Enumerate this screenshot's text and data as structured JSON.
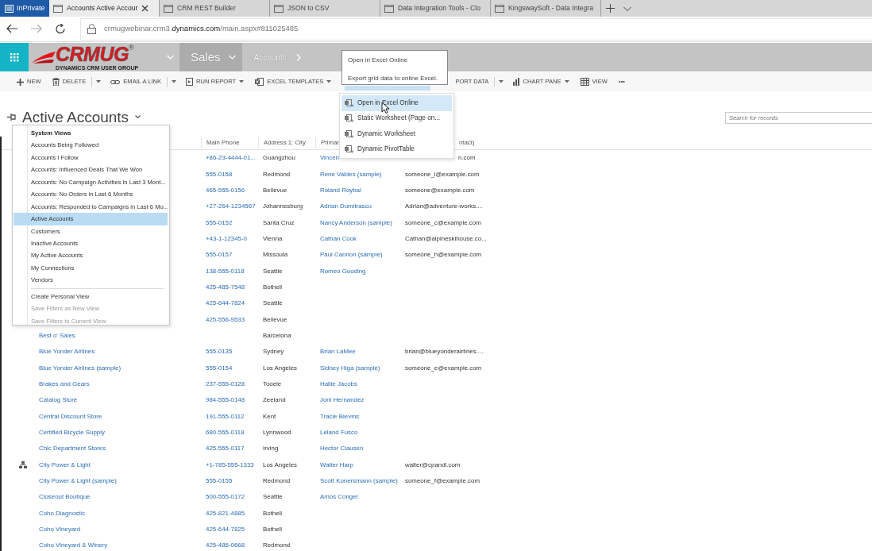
{
  "browser": {
    "private_label": "InPrivate",
    "tabs": [
      {
        "title": "Accounts Active Accour",
        "selected": true
      },
      {
        "title": "CRM REST Builder",
        "selected": false
      },
      {
        "title": "JSON to CSV",
        "selected": false
      },
      {
        "title": "Data Integration Tools - Clo",
        "selected": false
      },
      {
        "title": "KingswaySoft - Data Integra",
        "selected": false
      }
    ],
    "url": {
      "prefix": "crmugwebinar.crm3.",
      "domain": "dynamics.com",
      "path": "/main.aspx#811025485"
    }
  },
  "app_bar": {
    "logo": {
      "name": "CRMUG",
      "mark": "®",
      "tagline": "DYNAMICS CRM USER GROUP"
    },
    "area": "Sales",
    "breadcrumb": "Accounts"
  },
  "toolbar": {
    "items_before": [
      {
        "kind": "new",
        "label": "NEW",
        "dropdown": false
      },
      {
        "kind": "delete",
        "label": "DELETE",
        "dropdown": false
      },
      {
        "kind": "split",
        "dropdown": true
      },
      {
        "kind": "link",
        "label": "EMAIL A LINK",
        "dropdown": false
      },
      {
        "kind": "split",
        "dropdown": true
      },
      {
        "kind": "report",
        "label": "RUN REPORT",
        "dropdown": true
      },
      {
        "kind": "excel",
        "label": "EXCEL TEMPLATES",
        "dropdown": true
      }
    ],
    "export_button": {
      "highlighted": true
    },
    "items_after": [
      {
        "kind": "import",
        "label": "PORT DATA",
        "dropdown": false
      },
      {
        "kind": "split",
        "dropdown": true
      },
      {
        "kind": "chart",
        "label": "CHART PANE",
        "dropdown": true
      },
      {
        "kind": "view",
        "label": "VIEW",
        "dropdown": false
      },
      {
        "kind": "more",
        "label": "•••",
        "dropdown": false
      }
    ]
  },
  "tooltip": {
    "title": "Open in Excel Online",
    "description": "Export grid data to online Excel."
  },
  "export_menu": [
    {
      "label": "Open in Excel Online",
      "selected": true
    },
    {
      "label": "Static Worksheet (Page on...",
      "selected": false
    },
    {
      "label": "Dynamic Worksheet",
      "selected": false
    },
    {
      "label": "Dynamic PivotTable",
      "selected": false
    }
  ],
  "page_title": "Active Accounts",
  "search": {
    "placeholder": "Search for records"
  },
  "views_menu": {
    "heading": "System Views",
    "views": [
      {
        "label": "Accounts Being Followed",
        "selected": false
      },
      {
        "label": "Accounts I Follow",
        "selected": false
      },
      {
        "label": "Accounts: Influenced Deals That We Won",
        "selected": false
      },
      {
        "label": "Accounts: No Campaign Activities in Last 3 Mont...",
        "selected": false
      },
      {
        "label": "Accounts: No Orders in Last 6 Months",
        "selected": false
      },
      {
        "label": "Accounts: Responded to Campaigns in Last 6 Mo...",
        "selected": false
      },
      {
        "label": "Active Accounts",
        "selected": true
      },
      {
        "label": "Customers",
        "selected": false
      },
      {
        "label": "Inactive Accounts",
        "selected": false
      },
      {
        "label": "My Active Accounts",
        "selected": false
      },
      {
        "label": "My Connections",
        "selected": false
      },
      {
        "label": "Vendors",
        "selected": false
      }
    ],
    "actions": [
      {
        "label": "Create Personal View",
        "disabled": false
      },
      {
        "label": "Save Filters as New View",
        "disabled": true
      },
      {
        "label": "Save Filters to Current View",
        "disabled": true
      }
    ]
  },
  "grid": {
    "columns": [
      "Main Phone",
      "Address 1: City",
      "Primar",
      "ntact)"
    ],
    "rows": [
      {
        "phone": "+86-23-4444-01...",
        "city": "Guangzhou",
        "contact": "Vincen",
        "email": "n.com",
        "hierarchy": false
      },
      {
        "phone": "555-0158",
        "city": "Redmond",
        "contact": "Rene Valdes (sample)",
        "email": "someone_i@example.com",
        "hierarchy": false
      },
      {
        "phone": "465-555-0156",
        "city": "Bellevue",
        "contact": "Roland Roybal",
        "email": "someone@example.com",
        "hierarchy": false
      },
      {
        "phone": "+27-264-1234567",
        "city": "Johannesburg",
        "contact": "Adrian Dumitrascu",
        "email": "Adrian@adventure-works....",
        "hierarchy": false
      },
      {
        "phone": "555-0152",
        "city": "Santa Cruz",
        "contact": "Nancy Anderson (sample)",
        "email": "someone_c@example.com",
        "hierarchy": false
      },
      {
        "phone": "+43-1-12345-0",
        "city": "Vienna",
        "contact": "Cathan Cook",
        "email": "Cathan@alpineskihouse.co...",
        "hierarchy": false
      },
      {
        "phone": "555-0157",
        "city": "Missoula",
        "contact": "Paul Cannon (sample)",
        "email": "someone_h@example.com",
        "hierarchy": false
      },
      {
        "phone": "138-555-0118",
        "city": "Seattle",
        "contact": "Romeo Gooding",
        "hierarchy": false
      },
      {
        "phone": "425-485-7548",
        "city": "Bothell",
        "hierarchy": false
      },
      {
        "phone": "425-644-7824",
        "city": "Seattle",
        "hierarchy": false
      },
      {
        "phone": "425-556-9533",
        "city": "Bellevue",
        "hierarchy": false
      },
      {
        "name": "Best o' Sales",
        "city": "Barcelona",
        "hierarchy": false
      },
      {
        "name": "Blue Yonder Airlines",
        "phone": "555-0135",
        "city": "Sydney",
        "contact": "Brian LaMee",
        "email": "brian@blueyonderairlines....",
        "hierarchy": false
      },
      {
        "name": "Blue Yonder Airlines (sample)",
        "phone": "555-0154",
        "city": "Los Angeles",
        "contact": "Sidney Higa (sample)",
        "email": "someone_e@example.com",
        "hierarchy": false
      },
      {
        "name": "Brakes and Gears",
        "phone": "237-555-0128",
        "city": "Tooele",
        "contact": "Hallie Jacobs",
        "hierarchy": false
      },
      {
        "name": "Catalog Store",
        "phone": "984-555-0148",
        "city": "Zeeland",
        "contact": "Joni Hernandez",
        "hierarchy": false
      },
      {
        "name": "Central Discount Store",
        "phone": "191-555-0112",
        "city": "Kent",
        "contact": "Tracie Blevins",
        "hierarchy": false
      },
      {
        "name": "Certified Bicycle Supply",
        "phone": "680-555-0118",
        "city": "Lynnwood",
        "contact": "Leland Fusco",
        "hierarchy": false
      },
      {
        "name": "Chic Department Stores",
        "phone": "425-555-0117",
        "city": "Irving",
        "contact": "Hector Clausen",
        "hierarchy": false
      },
      {
        "name": "City Power & Light",
        "phone": "+1-785-555-1333",
        "city": "Los Angeles",
        "contact": "Walter Harp",
        "email": "walter@cpandl.com",
        "hierarchy": true
      },
      {
        "name": "City Power & Light (sample)",
        "phone": "555-0155",
        "city": "Redmond",
        "contact": "Scott Konersmann (sample)",
        "email": "someone_f@example.com",
        "hierarchy": false
      },
      {
        "name": "Closeout Boutique",
        "phone": "500-555-0172",
        "city": "Seattle",
        "contact": "Amos Conger",
        "hierarchy": false
      },
      {
        "name": "Coho Diagnostic",
        "phone": "425-821-4885",
        "city": "Bothell",
        "hierarchy": false
      },
      {
        "name": "Coho Vineyard",
        "phone": "425-644-7825",
        "city": "Bothell",
        "hierarchy": false
      },
      {
        "name": "Coho Vineyard & Winery",
        "phone": "425-486-0668",
        "city": "Redmond",
        "hierarchy": false
      }
    ]
  }
}
